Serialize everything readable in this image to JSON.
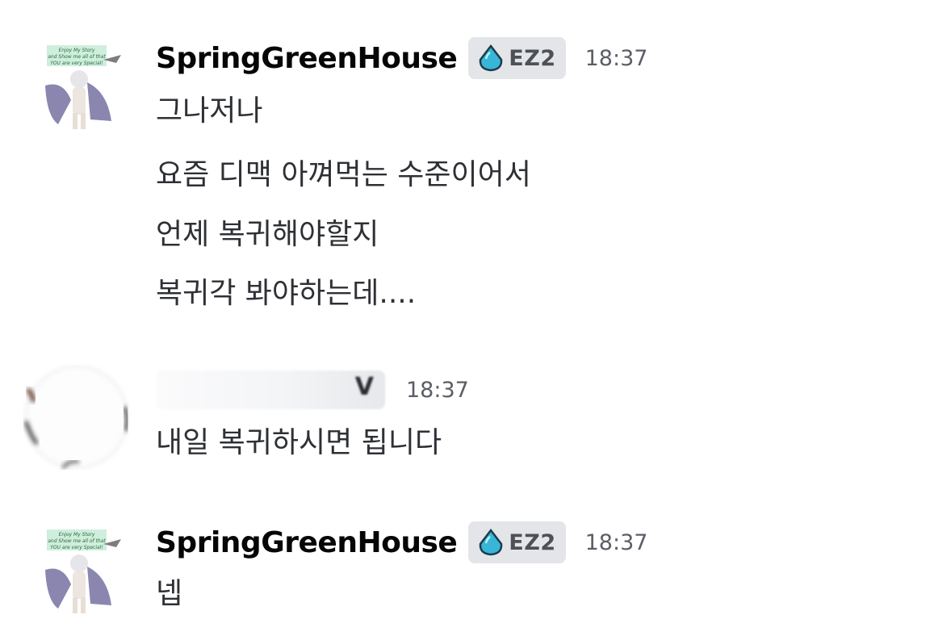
{
  "messages": [
    {
      "author": "SpringGreenHouse",
      "tag": {
        "label": "EZ2",
        "icon": "water-drop-icon",
        "color": "#38b6d8"
      },
      "time": "18:37",
      "lines": [
        "그나저나",
        "요즘 디맥 아껴먹는 수준이어서",
        "언제 복귀해야할지",
        "복귀각 봐야하는데...."
      ]
    },
    {
      "author_visible_fragment": "V",
      "author_blurred": true,
      "time": "18:37",
      "lines": [
        "내일 복귀하시면 됩니다"
      ]
    },
    {
      "author": "SpringGreenHouse",
      "tag": {
        "label": "EZ2",
        "icon": "water-drop-icon",
        "color": "#38b6d8"
      },
      "time": "18:37",
      "lines": [
        "넵"
      ]
    }
  ],
  "avatar_caption_lines": [
    "Enjoy My Story",
    "and Show me all of that",
    "YOU are very Special!"
  ],
  "colors": {
    "background": "#ffffff",
    "username": "#060607",
    "message_text": "#2e3035",
    "timestamp": "#5c5e66",
    "tag_background": "#e3e5e8"
  }
}
